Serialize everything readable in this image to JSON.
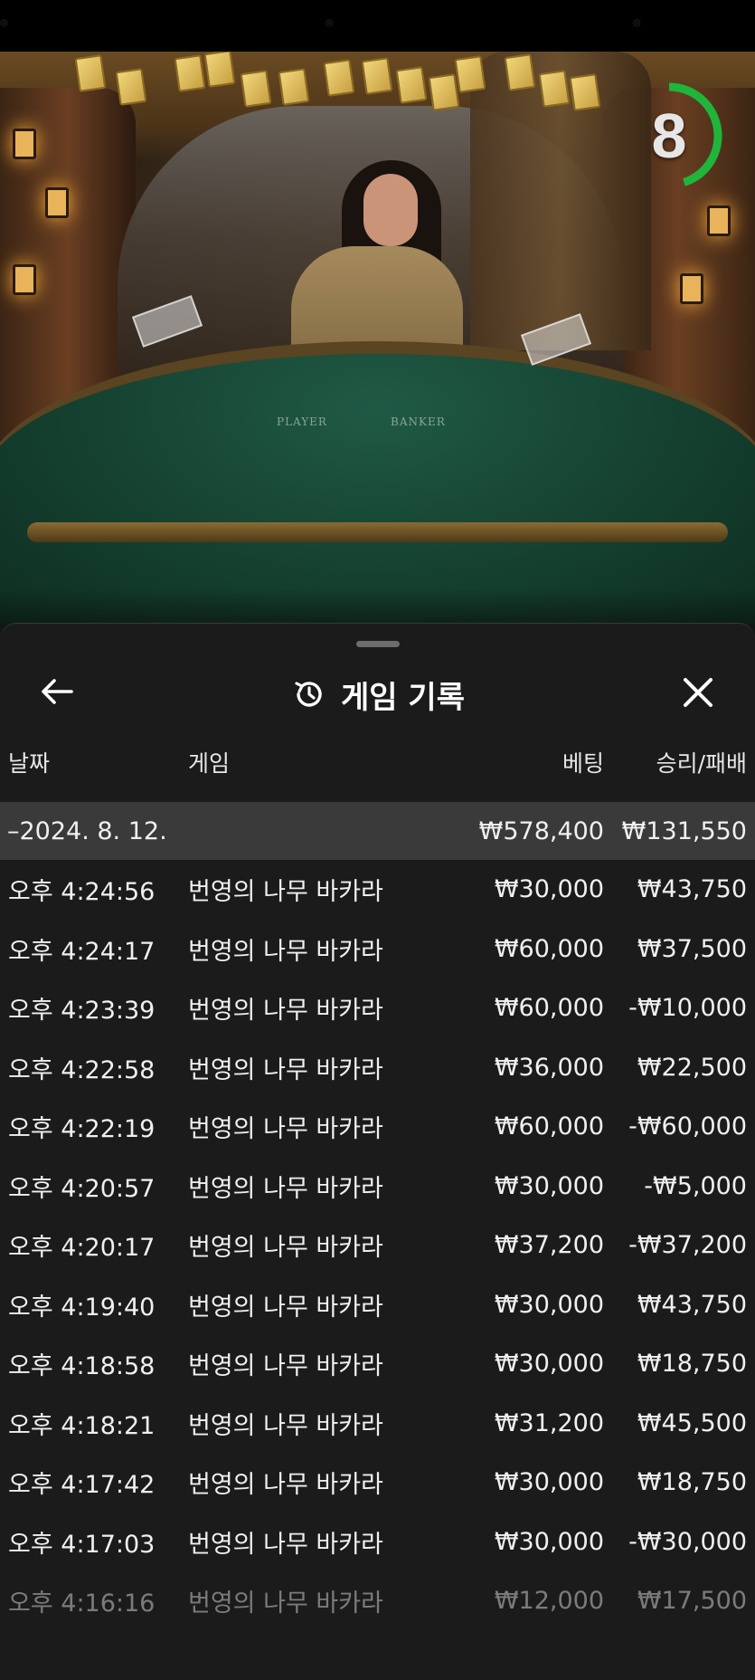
{
  "timer": {
    "value": "8",
    "fraction_remaining": 0.45,
    "color": "#1fb53a"
  },
  "video": {
    "table_labels": {
      "player": "PLAYER",
      "banker": "BANKER"
    }
  },
  "panel": {
    "title": "게임 기록",
    "title_icon": "history-icon",
    "back_icon": "arrow-left-icon",
    "close_icon": "close-icon",
    "columns": {
      "date": "날짜",
      "game": "게임",
      "bet": "베팅",
      "win_loss": "승리/패배"
    },
    "summary": {
      "date": "–2024. 8. 12.",
      "bet": "₩578,400",
      "win_loss": "₩131,550"
    },
    "rows": [
      {
        "time": "오후 4:24:56",
        "game": "번영의 나무 바카라",
        "bet": "₩30,000",
        "win_loss": "₩43,750"
      },
      {
        "time": "오후 4:24:17",
        "game": "번영의 나무 바카라",
        "bet": "₩60,000",
        "win_loss": "₩37,500"
      },
      {
        "time": "오후 4:23:39",
        "game": "번영의 나무 바카라",
        "bet": "₩60,000",
        "win_loss": "-₩10,000"
      },
      {
        "time": "오후 4:22:58",
        "game": "번영의 나무 바카라",
        "bet": "₩36,000",
        "win_loss": "₩22,500"
      },
      {
        "time": "오후 4:22:19",
        "game": "번영의 나무 바카라",
        "bet": "₩60,000",
        "win_loss": "-₩60,000"
      },
      {
        "time": "오후 4:20:57",
        "game": "번영의 나무 바카라",
        "bet": "₩30,000",
        "win_loss": "-₩5,000"
      },
      {
        "time": "오후 4:20:17",
        "game": "번영의 나무 바카라",
        "bet": "₩37,200",
        "win_loss": "-₩37,200"
      },
      {
        "time": "오후 4:19:40",
        "game": "번영의 나무 바카라",
        "bet": "₩30,000",
        "win_loss": "₩43,750"
      },
      {
        "time": "오후 4:18:58",
        "game": "번영의 나무 바카라",
        "bet": "₩30,000",
        "win_loss": "₩18,750"
      },
      {
        "time": "오후 4:18:21",
        "game": "번영의 나무 바카라",
        "bet": "₩31,200",
        "win_loss": "₩45,500"
      },
      {
        "time": "오후 4:17:42",
        "game": "번영의 나무 바카라",
        "bet": "₩30,000",
        "win_loss": "₩18,750"
      },
      {
        "time": "오후 4:17:03",
        "game": "번영의 나무 바카라",
        "bet": "₩30,000",
        "win_loss": "-₩30,000"
      },
      {
        "time": "오후 4:16:16",
        "game": "번영의 나무 바카라",
        "bet": "₩12,000",
        "win_loss": "₩17,500"
      }
    ]
  },
  "colors": {
    "panel_bg": "#1c1c1c",
    "summary_bg": "#3a3a3a",
    "text": "#f0f0f0"
  }
}
